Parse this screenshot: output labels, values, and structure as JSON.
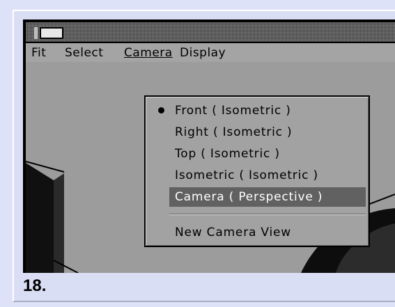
{
  "menubar": {
    "items": [
      {
        "label": "Fit"
      },
      {
        "label": "Select"
      },
      {
        "label": "Camera"
      },
      {
        "label": "Display"
      }
    ]
  },
  "camera_menu": {
    "items": [
      {
        "label": "Front  ( Isometric )",
        "checked": true
      },
      {
        "label": "Right  ( Isometric )",
        "checked": false
      },
      {
        "label": "Top  ( Isometric )",
        "checked": false
      },
      {
        "label": "Isometric  ( Isometric )",
        "checked": false
      },
      {
        "label": "Camera  ( Perspective )",
        "checked": false,
        "highlighted": true
      }
    ],
    "new_view_label": "New Camera View"
  },
  "step_label": "18.",
  "colors": {
    "page_bg": "#dde2f8",
    "menubar_bg": "#a4a4a4",
    "viewport_bg": "#9c9c9c",
    "highlight_bg": "#616161"
  }
}
